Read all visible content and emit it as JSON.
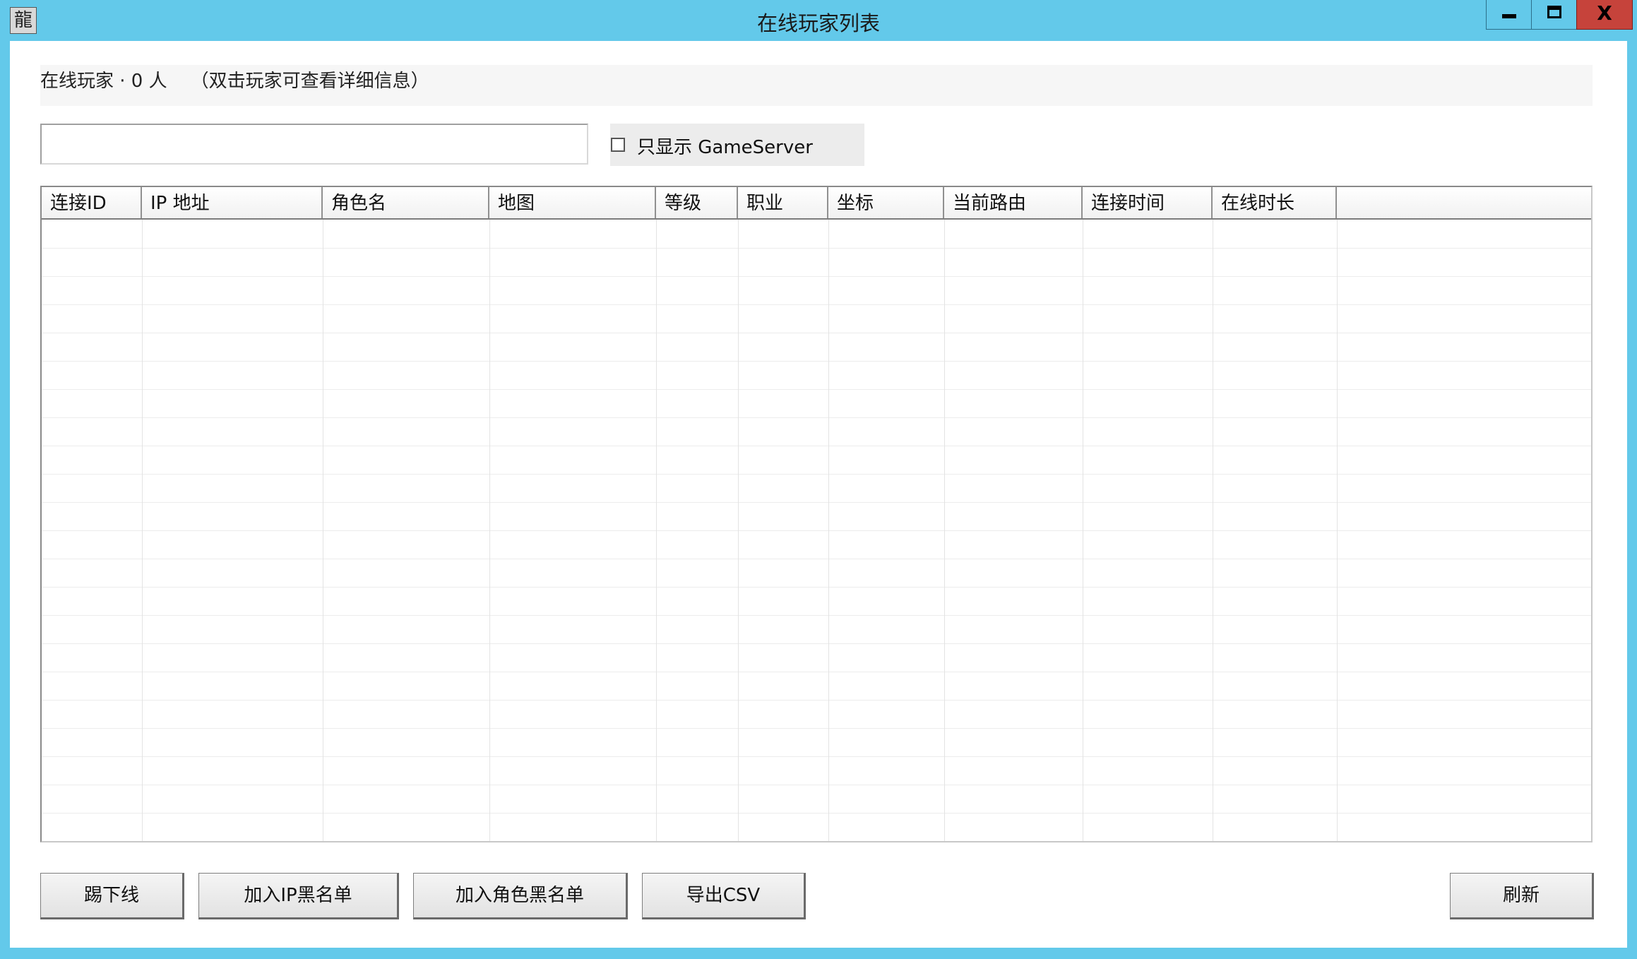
{
  "window": {
    "title": "在线玩家列表",
    "app_icon_glyph": "龍",
    "minimize_icon": "minimize-icon",
    "maximize_icon": "maximize-icon",
    "close_glyph": "X"
  },
  "info": {
    "text": "在线玩家 · 0 人    （双击玩家可查看详细信息）"
  },
  "search": {
    "value": "",
    "placeholder": ""
  },
  "filter": {
    "label": "只显示 GameServer",
    "checked": false
  },
  "table": {
    "columns": [
      "连接ID",
      "IP 地址",
      "角色名",
      "地图",
      "等级",
      "职业",
      "坐标",
      "当前路由",
      "连接时间",
      "在线时长",
      ""
    ],
    "rows": []
  },
  "buttons": {
    "kick": "踢下线",
    "ip_blacklist": "加入IP黑名单",
    "role_blacklist": "加入角色黑名单",
    "export_csv": "导出CSV",
    "refresh": "刷新"
  },
  "colors": {
    "title_bar": "#63c9ea",
    "close_button": "#c6433b"
  }
}
